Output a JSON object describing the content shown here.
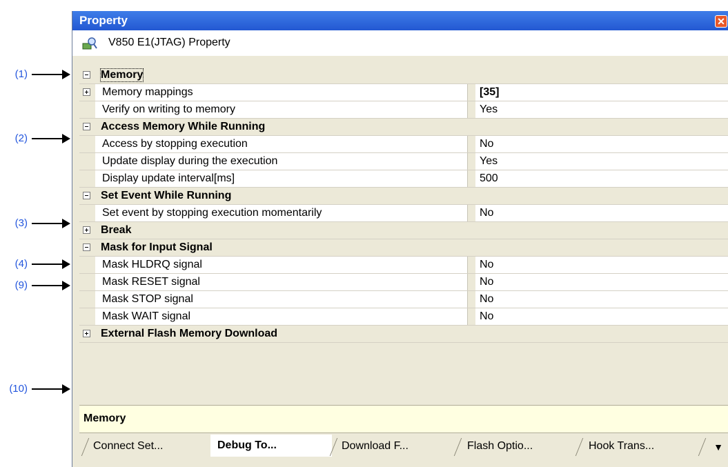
{
  "callouts": [
    {
      "label": "(1)",
      "row": "memory"
    },
    {
      "label": "(2)",
      "row": "access"
    },
    {
      "label": "(3)",
      "row": "event"
    },
    {
      "label": "(4)",
      "row": "break"
    },
    {
      "label": "(9)",
      "row": "mask"
    },
    {
      "label": "(10)",
      "row": "flash"
    }
  ],
  "panel": {
    "title": "Property",
    "close_icon": "close-icon",
    "subtitle": "V850 E1(JTAG) Property",
    "subtitle_icon": "property-icon"
  },
  "grid": {
    "memory_cat": "Memory",
    "memory_mappings": {
      "name": "Memory mappings",
      "value": "[35]"
    },
    "verify": {
      "name": "Verify on writing to memory",
      "value": "Yes"
    },
    "access_cat": "Access Memory While Running",
    "access_stop": {
      "name": "Access by stopping execution",
      "value": "No"
    },
    "update_display": {
      "name": "Update display during the execution",
      "value": "Yes"
    },
    "update_interval": {
      "name": "Display update interval[ms]",
      "value": "500"
    },
    "event_cat": "Set Event While Running",
    "event_stop": {
      "name": "Set event by stopping execution momentarily",
      "value": "No"
    },
    "break_cat": "Break",
    "mask_cat": "Mask for Input Signal",
    "mask_hldrq": {
      "name": "Mask HLDRQ signal",
      "value": "No"
    },
    "mask_reset": {
      "name": "Mask RESET signal",
      "value": "No"
    },
    "mask_stop": {
      "name": "Mask STOP signal",
      "value": "No"
    },
    "mask_wait": {
      "name": "Mask WAIT signal",
      "value": "No"
    },
    "flash_cat": "External Flash Memory Download"
  },
  "description": "Memory",
  "tabs": [
    "Connect Set...",
    "Debug To...",
    "Download F...",
    "Flash Optio...",
    "Hook Trans..."
  ],
  "active_tab": "Debug To..."
}
